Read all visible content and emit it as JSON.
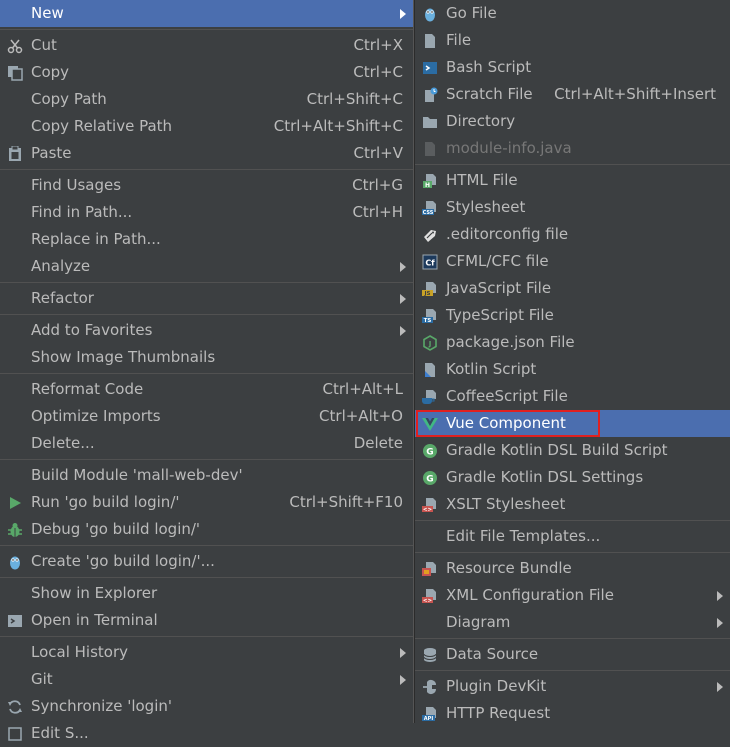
{
  "main_menu": {
    "new": "New",
    "cut": {
      "label": "Cut",
      "shortcut": "Ctrl+X"
    },
    "copy": {
      "label": "Copy",
      "shortcut": "Ctrl+C"
    },
    "copy_path": {
      "label": "Copy Path",
      "shortcut": "Ctrl+Shift+C"
    },
    "copy_relative_path": {
      "label": "Copy Relative Path",
      "shortcut": "Ctrl+Alt+Shift+C"
    },
    "paste": {
      "label": "Paste",
      "shortcut": "Ctrl+V"
    },
    "find_usages": {
      "label": "Find Usages",
      "shortcut": "Ctrl+G"
    },
    "find_in_path": {
      "label": "Find in Path...",
      "shortcut": "Ctrl+H"
    },
    "replace_in_path": {
      "label": "Replace in Path..."
    },
    "analyze": {
      "label": "Analyze"
    },
    "refactor": {
      "label": "Refactor"
    },
    "add_to_favorites": {
      "label": "Add to Favorites"
    },
    "show_image_thumbnails": {
      "label": "Show Image Thumbnails"
    },
    "reformat_code": {
      "label": "Reformat Code",
      "shortcut": "Ctrl+Alt+L"
    },
    "optimize_imports": {
      "label": "Optimize Imports",
      "shortcut": "Ctrl+Alt+O"
    },
    "delete": {
      "label": "Delete...",
      "shortcut": "Delete"
    },
    "build_module": {
      "label": "Build Module 'mall-web-dev'"
    },
    "run": {
      "label": "Run 'go build login/'",
      "shortcut": "Ctrl+Shift+F10"
    },
    "debug": {
      "label": "Debug 'go build login/'"
    },
    "create": {
      "label": "Create 'go build login/'..."
    },
    "show_in_explorer": {
      "label": "Show in Explorer"
    },
    "open_in_terminal": {
      "label": "Open in Terminal"
    },
    "local_history": {
      "label": "Local History"
    },
    "git": {
      "label": "Git"
    },
    "synchronize": {
      "label": "Synchronize 'login'"
    },
    "edit_scopes": {
      "label": "Edit S..."
    }
  },
  "sub_menu": {
    "go_file": "Go File",
    "file": "File",
    "bash_script": "Bash Script",
    "scratch_file": {
      "label": "Scratch File",
      "shortcut": "Ctrl+Alt+Shift+Insert"
    },
    "directory": "Directory",
    "module_info": "module-info.java",
    "html_file": "HTML File",
    "stylesheet": "Stylesheet",
    "editorconfig": ".editorconfig file",
    "cfml": "CFML/CFC file",
    "javascript": "JavaScript File",
    "typescript": "TypeScript File",
    "package_json": "package.json File",
    "kotlin_script": "Kotlin Script",
    "coffeescript": "CoffeeScript File",
    "vue_component": "Vue Component",
    "gradle_kotlin_build": "Gradle Kotlin DSL Build Script",
    "gradle_kotlin_settings": "Gradle Kotlin DSL Settings",
    "xslt": "XSLT Stylesheet",
    "edit_templates": "Edit File Templates...",
    "resource_bundle": "Resource Bundle",
    "xml_config": "XML Configuration File",
    "diagram": "Diagram",
    "data_source": "Data Source",
    "plugin_devkit": "Plugin DevKit",
    "http_request": "HTTP Request"
  },
  "icon_badges": {
    "h": "H",
    "css": "CSS",
    "cf": "Cf",
    "js": "JS",
    "ts": "TS",
    "gradle": "G",
    "api": "API"
  },
  "colors": {
    "background": "#3c3f41",
    "selected": "#4b6eaf",
    "highlight_border": "#e02020",
    "text": "#bbbbbb"
  }
}
